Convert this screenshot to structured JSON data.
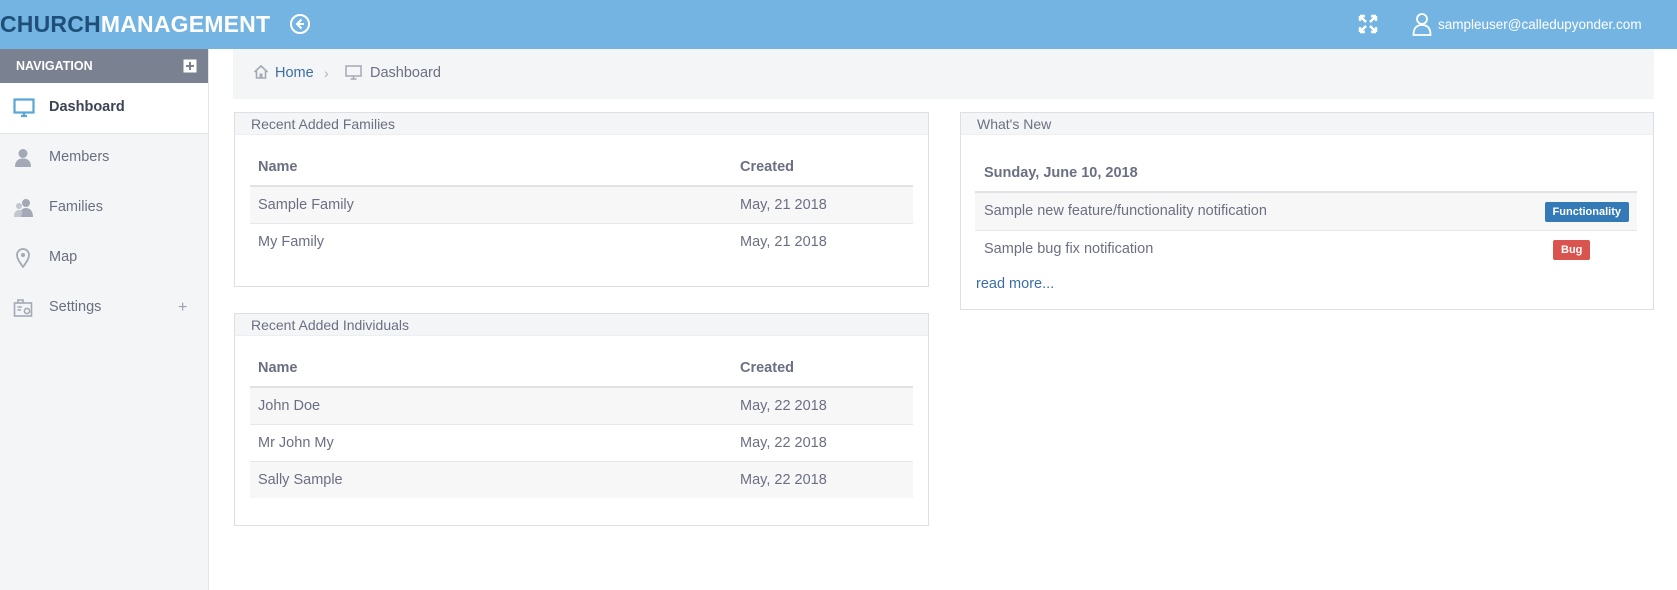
{
  "app": {
    "brand_part1": "CHURCH",
    "brand_part2": "MANAGEMENT",
    "user_email": "sampleuser@calledupyonder.com"
  },
  "colors": {
    "topbar": "#74b4e2",
    "brand_dark": "#1e4f79",
    "link": "#3a6ea5",
    "badge_functionality": "#337ab7",
    "badge_bug": "#d9534f"
  },
  "icons": {
    "back": "circle-arrow-left-icon",
    "expand": "expand-arrows-icon",
    "user": "user-outline-icon",
    "home": "home-icon",
    "monitor": "monitor-icon",
    "members": "person-icon",
    "families": "people-icon",
    "map": "map-pin-icon",
    "settings": "settings-building-icon"
  },
  "sidebar": {
    "header": "NAVIGATION",
    "items": [
      {
        "label": "Dashboard",
        "active": true
      },
      {
        "label": "Members",
        "active": false
      },
      {
        "label": "Families",
        "active": false
      },
      {
        "label": "Map",
        "active": false
      },
      {
        "label": "Settings",
        "active": false,
        "expand": "+"
      }
    ]
  },
  "breadcrumb": {
    "home": "Home",
    "separator": "›",
    "current": "Dashboard"
  },
  "families_panel": {
    "title": "Recent Added Families",
    "columns": [
      "Name",
      "Created"
    ],
    "rows": [
      [
        "Sample Family",
        "May, 21 2018"
      ],
      [
        "My Family",
        "May, 21 2018"
      ]
    ]
  },
  "individuals_panel": {
    "title": "Recent Added Individuals",
    "columns": [
      "Name",
      "Created"
    ],
    "rows": [
      [
        "John Doe",
        "May, 22 2018"
      ],
      [
        "Mr John My",
        "May, 22 2018"
      ],
      [
        "Sally Sample",
        "May, 22 2018"
      ]
    ]
  },
  "news_panel": {
    "title": "What's New",
    "date": "Sunday, June 10, 2018",
    "items": [
      {
        "text": "Sample new feature/functionality notification",
        "badge": "Functionality"
      },
      {
        "text": "Sample bug fix notification",
        "badge": "Bug"
      }
    ],
    "read_more": "read more..."
  }
}
